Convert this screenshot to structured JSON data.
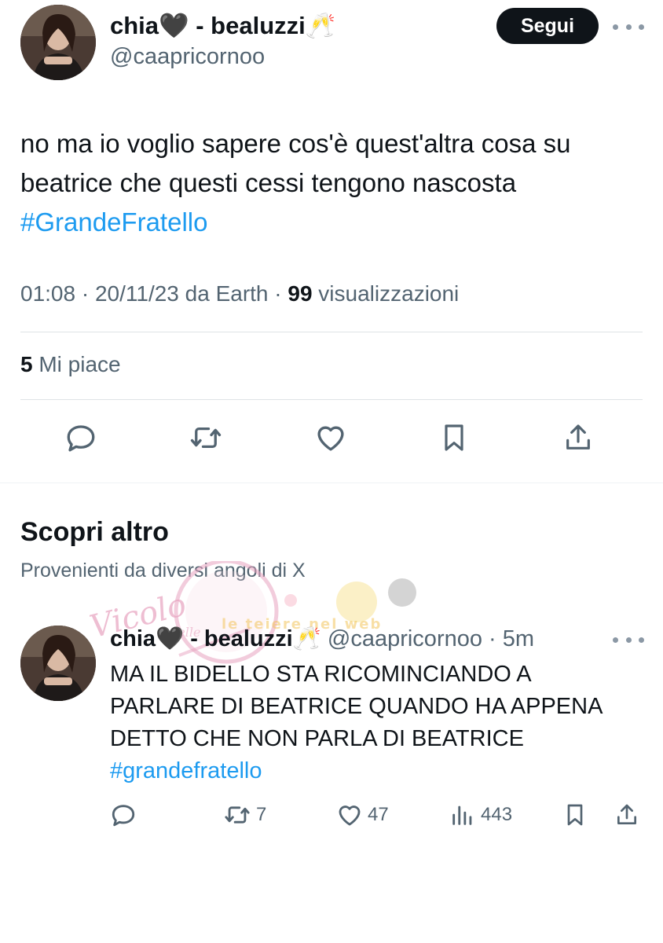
{
  "tweet": {
    "display_name": "chia🖤 - bealuzzi🥂",
    "handle": "@caapricornoo",
    "follow_label": "Segui",
    "text_lines": [
      "no ma io voglio sapere cos'è quest'altra cosa su",
      "beatrice che questi cessi tengono nascosta"
    ],
    "hashtag": "#GrandeFratello",
    "meta_prefix": "01:08 · 20/11/23 da Earth · ",
    "views_count": "99",
    "views_label": " visualizzazioni",
    "likes_count": "5",
    "likes_label": " Mi piace",
    "actions": [
      "reply-icon",
      "retweet-icon",
      "like-icon",
      "bookmark-icon",
      "share-icon"
    ]
  },
  "discover": {
    "title": "Scopri altro",
    "subtitle": "Provenienti da diversi angoli di X"
  },
  "reply_tweet": {
    "display_name": "chia🖤 - bealuzzi🥂",
    "handle_time": " @caapricornoo · 5m",
    "text_lines": [
      "MA IL BIDELLO STA RICOMINCIANDO A",
      "PARLARE DI BEATRICE QUANDO HA APPENA",
      "DETTO CHE NON PARLA DI BEATRICE"
    ],
    "hashtag": "#grandefratello",
    "retweets": "7",
    "likes": "47",
    "views": "443"
  },
  "watermark": {
    "text": "Vicolo delle News",
    "secondary": "le teiere nel web"
  },
  "colors": {
    "hashtag": "#1d9bf0",
    "secondary_text": "#536471",
    "follow_bg": "#0f1419"
  }
}
